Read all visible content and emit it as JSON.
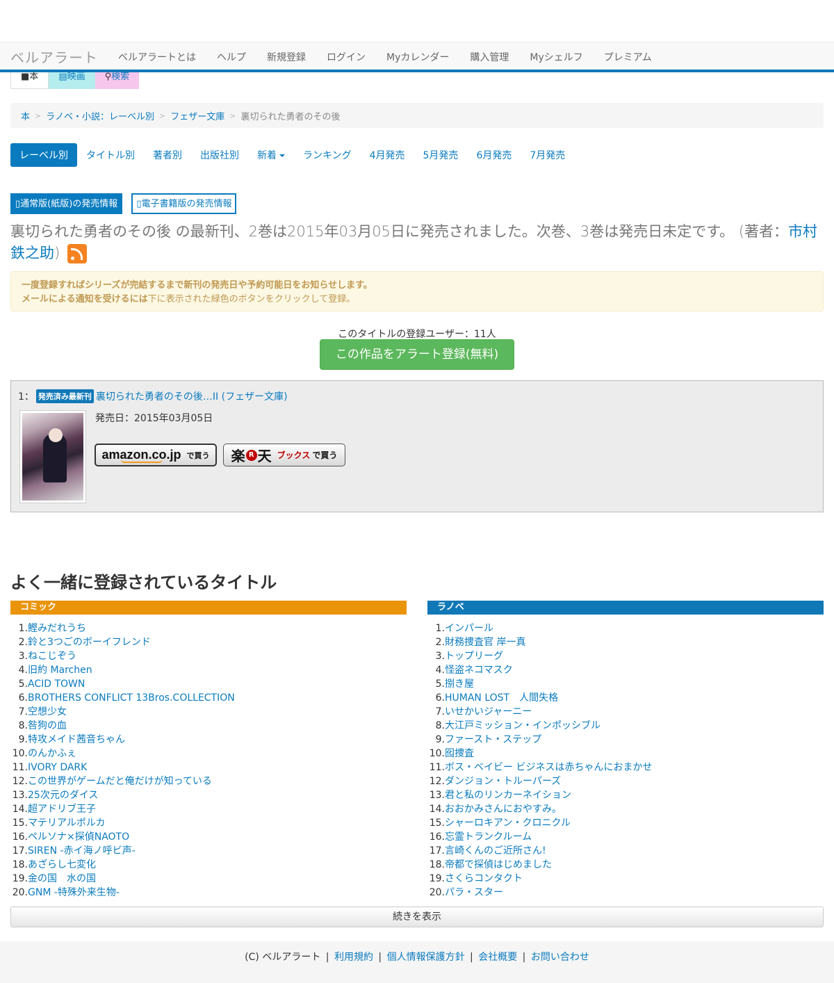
{
  "navbar": {
    "brand": "ベルアラート",
    "menu": [
      "ベルアラートとは",
      "ヘルプ",
      "新規登録",
      "ログイン",
      "Myカレンダー",
      "購入管理",
      "Myシェルフ",
      "プレミアム"
    ]
  },
  "media_tabs": {
    "book": "本",
    "movie": "映画",
    "search": "検索"
  },
  "breadcrumb": {
    "items": [
      "本",
      "ラノベ・小説：レーベル別",
      "フェザー文庫"
    ],
    "current": "裏切られた勇者のその後"
  },
  "pills": {
    "items": [
      "レーベル別",
      "タイトル別",
      "著者別",
      "出版社別",
      "新着",
      "ランキング",
      "4月発売",
      "5月発売",
      "6月発売",
      "7月発売"
    ]
  },
  "edition": {
    "paper": "通常版(紙版)の発売情報",
    "ebook": "電子書籍版の発売情報"
  },
  "headline": {
    "text": "裏切られた勇者のその後 の最新刊、2巻は2015年03月05日に発売されました。次巻、3巻は発売日未定です。 (著者：",
    "author": "市村鉄之助",
    "close": ")"
  },
  "alert": {
    "line1": "一度登録すればシリーズが完結するまで新刊の発売日や予約可能日をお知らせします。",
    "line2_bold": "メールによる通知を受けるには",
    "line2_rest": "下に表示された緑色のボタンをクリックして登録。"
  },
  "register": {
    "count": "このタイトルの登録ユーザー：11人",
    "button": "この作品をアラート登録(無料)"
  },
  "volume": {
    "index": "1：",
    "badge": "発売済み最新刊",
    "title": "裏切られた勇者のその後…II (フェザー文庫)",
    "release": "発売日：2015年03月05日",
    "amazon_logo": "amazon.co.jp",
    "amazon_buy": "で買う",
    "rakuten_a": "楽",
    "rakuten_r": "R",
    "rakuten_b": "天",
    "rakuten_books": "ブックス",
    "rakuten_buy": "で買う"
  },
  "related": {
    "title": "よく一緒に登録されているタイトル",
    "comic": {
      "label": "コミック",
      "items": [
        "鰹みだれうち",
        "鈴と3つごのボーイフレンド",
        "ねこじぞう",
        "旧約 Marchen",
        "ACID TOWN",
        "BROTHERS CONFLICT 13Bros.COLLECTION",
        "空想少女",
        "咎狗の血",
        "特攻メイド茜音ちゃん",
        "のんかふぇ",
        "IVORY DARK",
        "この世界がゲームだと俺だけが知っている",
        "25次元のダイス",
        "超アドリブ王子",
        "マテリアルポルカ",
        "ペルソナ×探偵NAOTO",
        "SIREN -赤イ海ノ呼ビ声-",
        "あざらし七変化",
        "金の国　水の国",
        "GNM -特殊外来生物-"
      ]
    },
    "ranobe": {
      "label": "ラノベ",
      "items": [
        "インパール",
        "財務捜査官 岸一真",
        "トップリーグ",
        "怪盗ネコマスク",
        "捌き屋",
        "HUMAN LOST　人間失格",
        "いせかいジャーニー",
        "大江戸ミッション・インポッシブル",
        "ファースト・ステップ",
        "囮捜査",
        "ボス・ベイビー ビジネスは赤ちゃんにおまかせ",
        "ダンジョン・トルーパーズ",
        "君と私のリンカーネイション",
        "おおかみさんにおやすみ。",
        "シャーロキアン・クロニクル",
        "忘霊トランクルーム",
        "言崎くんのご近所さん!",
        "帝都で探偵はじめました",
        "さくらコンタクト",
        "パラ・スター"
      ]
    },
    "more": "続きを表示"
  },
  "footer": {
    "copy": "(C) ベルアラート",
    "links": [
      "利用規約",
      "個人情報保護方針",
      "会社概要",
      "お問い合わせ"
    ]
  }
}
